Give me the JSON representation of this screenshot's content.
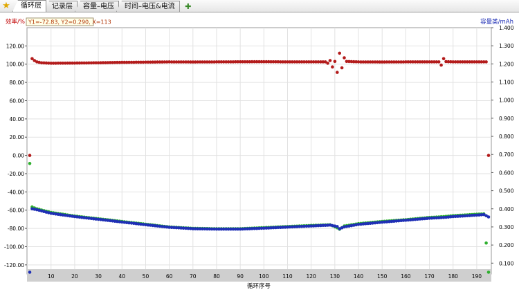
{
  "tabs": [
    {
      "label": "循环层",
      "active": true
    },
    {
      "label": "记录层",
      "active": false
    },
    {
      "label": "容量–电压",
      "active": false
    },
    {
      "label": "时间–电压&电流",
      "active": false
    }
  ],
  "colors": {
    "efficiency": "#b31b1b",
    "charge_capacity": "#2fb02f",
    "discharge_capacity": "#1f2fb5",
    "left_axis": "#c00000",
    "right_axis": "#1f2fb5"
  },
  "chart_data": {
    "type": "scatter",
    "xlabel": "循环序号",
    "ylabel_left": "效率/%",
    "ylabel_right": "容量类/mAh",
    "readout": "Y1=-72.83, Y2=0.290, X=113",
    "x_range": [
      1,
      195
    ],
    "x_ticks": [
      10,
      20,
      30,
      40,
      50,
      60,
      70,
      80,
      90,
      100,
      110,
      120,
      130,
      140,
      150,
      160,
      170,
      180,
      190
    ],
    "y_left_range": [
      -130,
      140
    ],
    "y_left_ticks": [
      -120,
      -100,
      -80,
      -60,
      -40,
      -20,
      0,
      20,
      40,
      60,
      80,
      100,
      120
    ],
    "y_left_tick_labels": [
      "-120.00",
      "-100.00",
      "-80.00",
      "-60.00",
      "-40.00",
      "-20.00",
      "0.00",
      "20.00",
      "40.00",
      "60.00",
      "80.00",
      "100.00",
      "120.00"
    ],
    "y_right_range": [
      0.04,
      1.4
    ],
    "y_right_ticks": [
      0.1,
      0.2,
      0.3,
      0.4,
      0.5,
      0.6,
      0.7,
      0.8,
      0.9,
      1.0,
      1.1,
      1.2,
      1.3,
      1.4
    ],
    "y_right_tick_labels": [
      "0.100",
      "0.200",
      "0.300",
      "0.400",
      "0.500",
      "0.600",
      "0.700",
      "0.800",
      "0.900",
      "1.000",
      "1.100",
      "1.200",
      "1.300",
      "1.400"
    ],
    "grid": true,
    "series": [
      {
        "key": "efficiency",
        "axis": "left",
        "points": [
          [
            1,
            0
          ],
          [
            2,
            106
          ],
          [
            3,
            104
          ],
          [
            4,
            102.5
          ],
          [
            6,
            101.5
          ],
          [
            10,
            101
          ],
          [
            20,
            101.2
          ],
          [
            30,
            101.5
          ],
          [
            40,
            102
          ],
          [
            50,
            102.2
          ],
          [
            60,
            102.5
          ],
          [
            70,
            102.4
          ],
          [
            80,
            102.5
          ],
          [
            90,
            102.6
          ],
          [
            100,
            102.7
          ],
          [
            110,
            102.5
          ],
          [
            120,
            102.5
          ],
          [
            126,
            102.5
          ],
          [
            127,
            101
          ],
          [
            128,
            104
          ],
          [
            129,
            97
          ],
          [
            130,
            103
          ],
          [
            131,
            91
          ],
          [
            132,
            112
          ],
          [
            133,
            96
          ],
          [
            134,
            107
          ],
          [
            135,
            103
          ],
          [
            140,
            102.5
          ],
          [
            150,
            102.4
          ],
          [
            160,
            102.5
          ],
          [
            170,
            102.5
          ],
          [
            174,
            102.5
          ],
          [
            175,
            99
          ],
          [
            176,
            106
          ],
          [
            177,
            102.8
          ],
          [
            180,
            102.5
          ],
          [
            190,
            102.5
          ],
          [
            194,
            102.5
          ],
          [
            195,
            0
          ]
        ]
      },
      {
        "key": "charge_capacity",
        "axis": "right",
        "points": [
          [
            1,
            0.65
          ],
          [
            2,
            0.41
          ],
          [
            4,
            0.4
          ],
          [
            10,
            0.38
          ],
          [
            20,
            0.36
          ],
          [
            30,
            0.345
          ],
          [
            40,
            0.33
          ],
          [
            50,
            0.315
          ],
          [
            60,
            0.3
          ],
          [
            70,
            0.292
          ],
          [
            80,
            0.29
          ],
          [
            90,
            0.29
          ],
          [
            100,
            0.296
          ],
          [
            110,
            0.302
          ],
          [
            120,
            0.308
          ],
          [
            128,
            0.312
          ],
          [
            131,
            0.295
          ],
          [
            132,
            0.287
          ],
          [
            134,
            0.305
          ],
          [
            140,
            0.318
          ],
          [
            150,
            0.33
          ],
          [
            160,
            0.34
          ],
          [
            170,
            0.352
          ],
          [
            176,
            0.357
          ],
          [
            180,
            0.362
          ],
          [
            190,
            0.37
          ],
          [
            193,
            0.372
          ],
          [
            195,
            0.05
          ]
        ]
      },
      {
        "key": "discharge_capacity",
        "axis": "right",
        "points": [
          [
            1,
            0.05
          ],
          [
            2,
            0.4
          ],
          [
            4,
            0.395
          ],
          [
            10,
            0.375
          ],
          [
            20,
            0.357
          ],
          [
            30,
            0.342
          ],
          [
            40,
            0.327
          ],
          [
            50,
            0.312
          ],
          [
            60,
            0.298
          ],
          [
            70,
            0.29
          ],
          [
            80,
            0.288
          ],
          [
            90,
            0.288
          ],
          [
            100,
            0.293
          ],
          [
            110,
            0.299
          ],
          [
            120,
            0.305
          ],
          [
            128,
            0.31
          ],
          [
            131,
            0.302
          ],
          [
            132,
            0.29
          ],
          [
            134,
            0.3
          ],
          [
            140,
            0.314
          ],
          [
            150,
            0.326
          ],
          [
            160,
            0.337
          ],
          [
            170,
            0.348
          ],
          [
            176,
            0.352
          ],
          [
            180,
            0.357
          ],
          [
            190,
            0.365
          ],
          [
            193,
            0.368
          ],
          [
            195,
            0.355
          ]
        ]
      }
    ]
  }
}
